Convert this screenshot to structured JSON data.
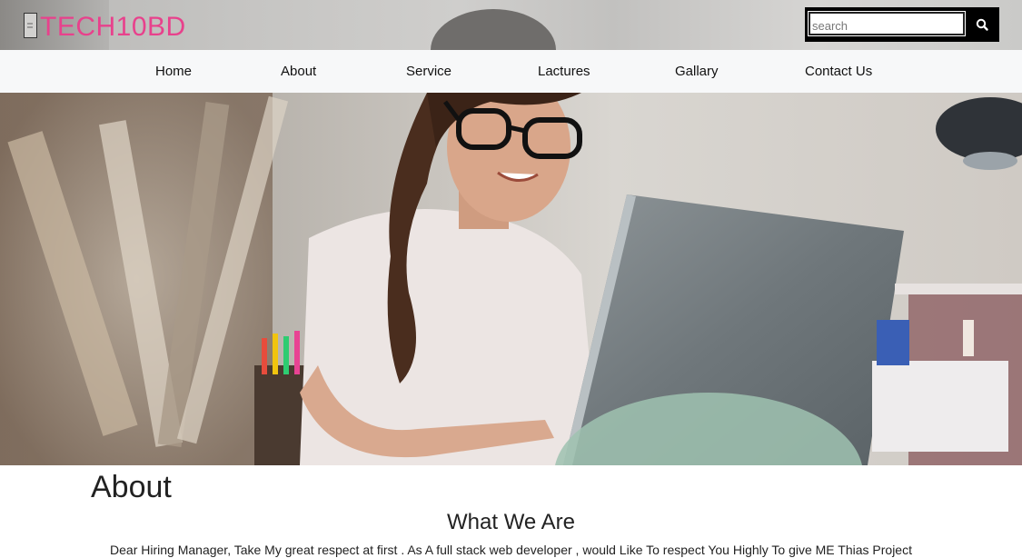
{
  "header": {
    "logo_text": "TECH10BD",
    "logo_icon": "logo-mark-icon",
    "search": {
      "placeholder": "search",
      "value": "",
      "icon": "search-icon"
    }
  },
  "nav": {
    "items": [
      {
        "label": "Home"
      },
      {
        "label": "About"
      },
      {
        "label": "Service"
      },
      {
        "label": "Lactures"
      },
      {
        "label": "Gallary"
      },
      {
        "label": "Contact Us"
      }
    ]
  },
  "hero": {
    "image": "woman-with-laptop-photo"
  },
  "about": {
    "heading": "About",
    "subheading": "What We Are",
    "text": "Dear Hiring Manager, Take My great respect at first . As A full stack web developer , would Like To respect You Highly To give ME Thias Project"
  },
  "colors": {
    "logo": "#e8418c",
    "nav_bg": "#f7f8f9",
    "search_bg": "#000000"
  }
}
